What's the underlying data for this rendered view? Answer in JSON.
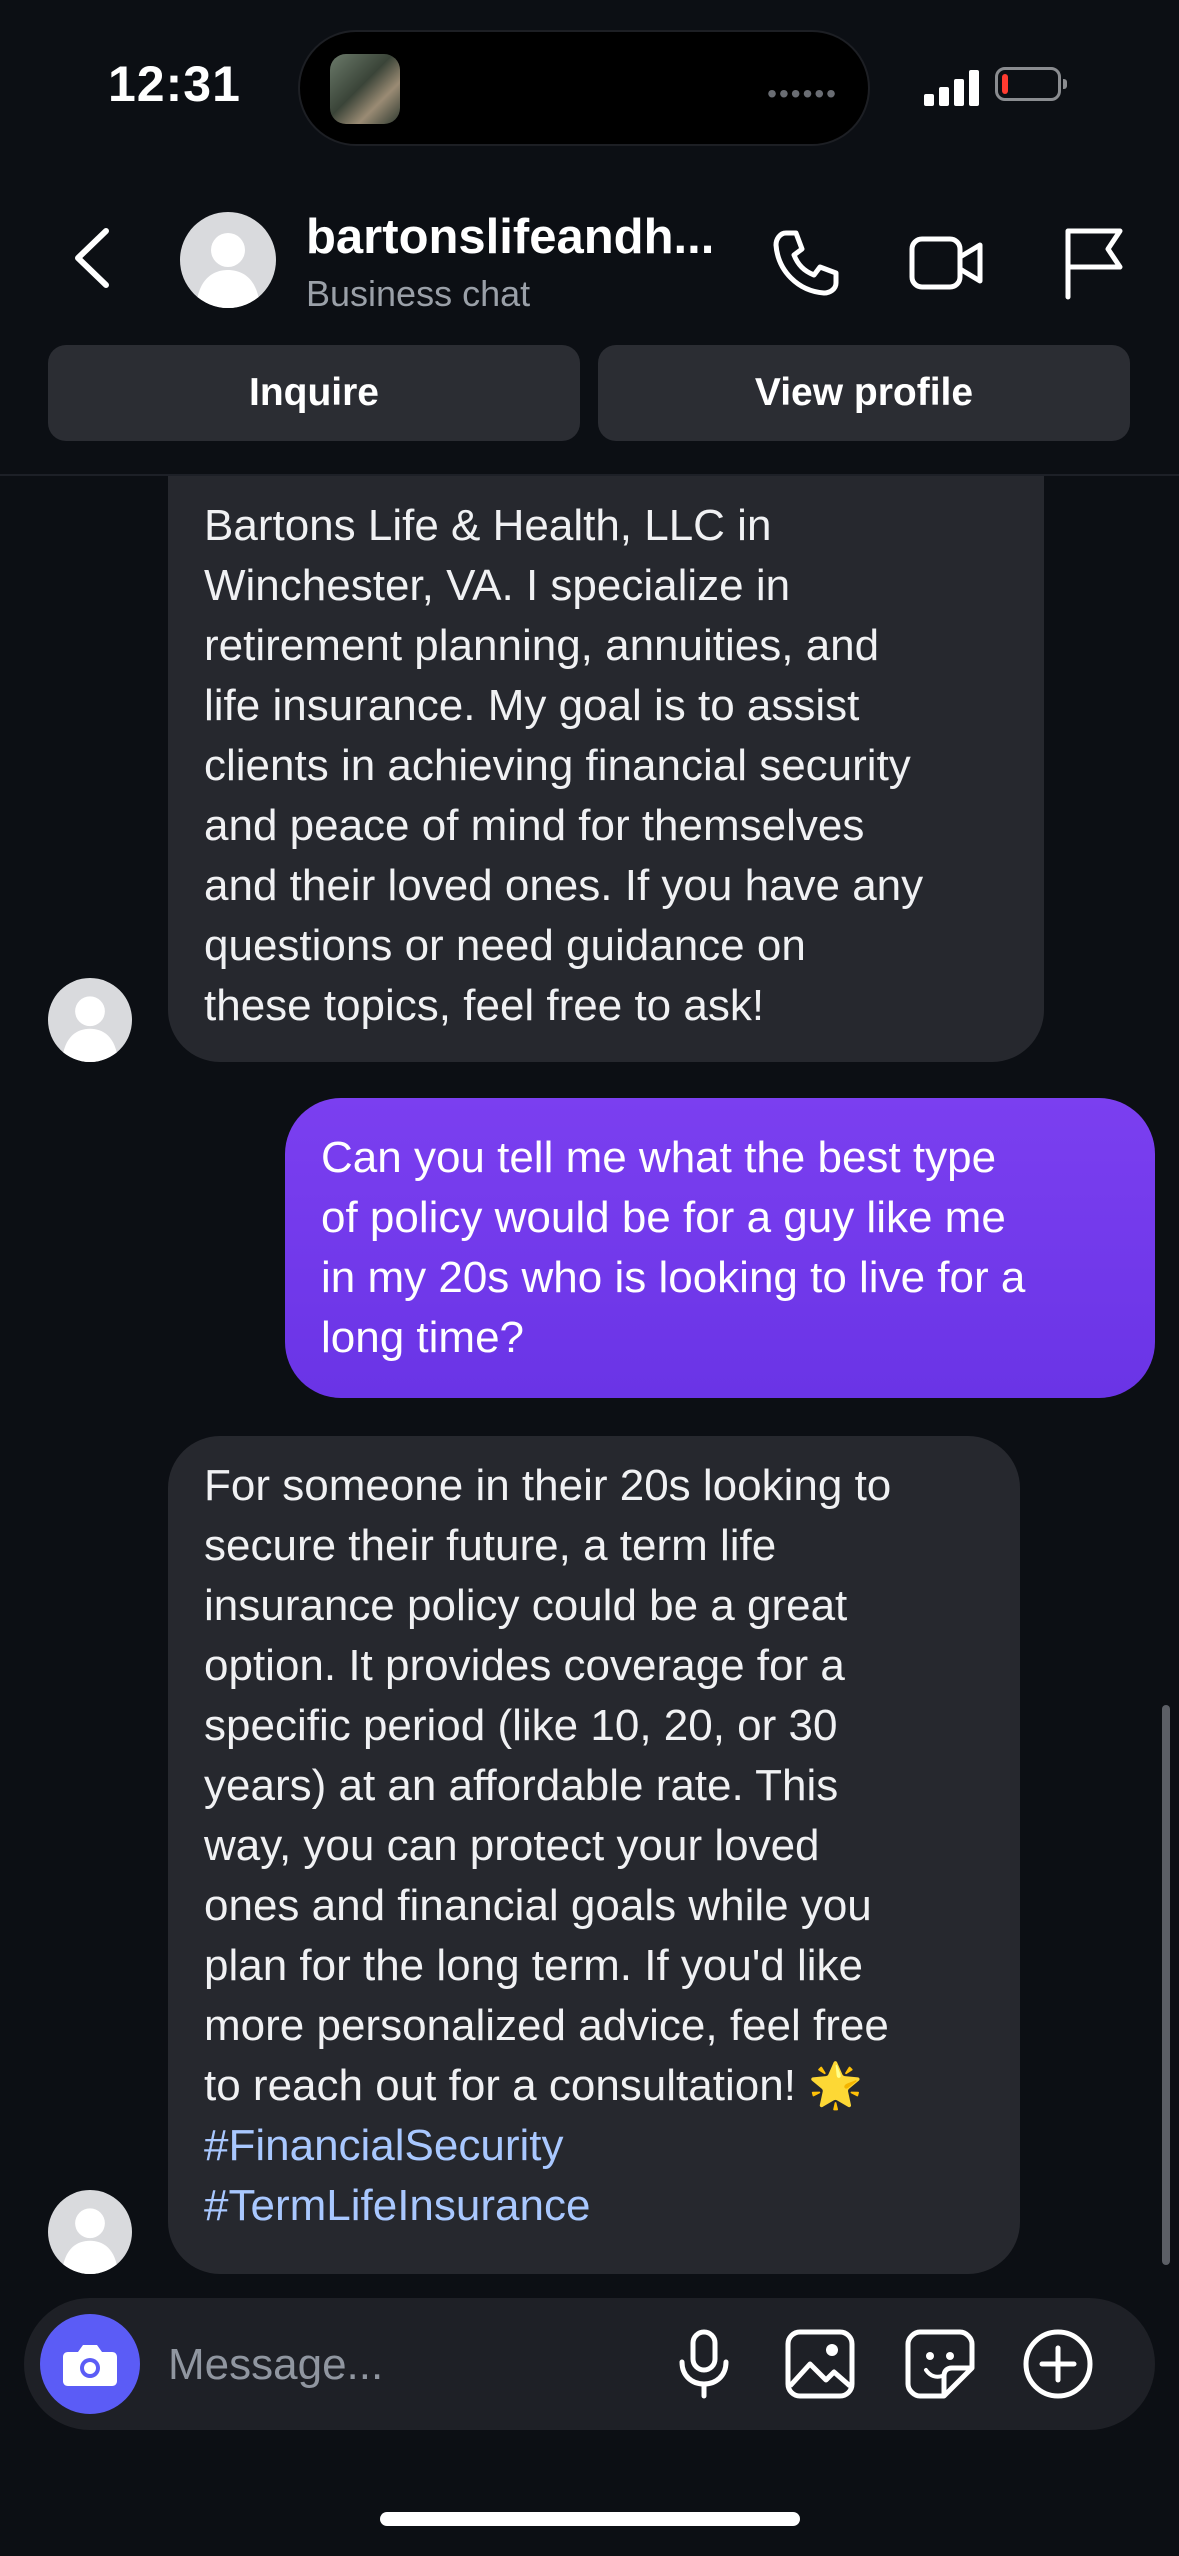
{
  "status_bar": {
    "time": "12:31",
    "island_dots": "••••••",
    "battery_color": "#ff3b30"
  },
  "header": {
    "name": "bartonslifeandh...",
    "subtitle": "Business chat",
    "icons": [
      "back-chevron-icon",
      "phone-icon",
      "video-camera-icon",
      "flag-icon"
    ]
  },
  "actions": {
    "inquire_label": "Inquire",
    "view_profile_label": "View profile"
  },
  "messages": [
    {
      "direction": "incoming",
      "lines": [
        "Bartons Life & Health, LLC in",
        "Winchester, VA. I specialize in",
        "retirement planning, annuities, and",
        "life insurance. My goal is to assist",
        "clients in achieving financial security",
        "and peace of mind for themselves",
        "and their loved ones. If you have any",
        "questions or need guidance on",
        "these topics, feel free to ask!"
      ]
    },
    {
      "direction": "outgoing",
      "lines": [
        "Can you tell me what the best type",
        "of policy would be for a guy like me",
        "in my 20s who is looking to live for a",
        "long time?"
      ]
    },
    {
      "direction": "incoming",
      "lines": [
        "For someone in their 20s looking to",
        "secure their future, a term life",
        "insurance policy could be a great",
        "option. It provides coverage for a",
        "specific period (like 10, 20, or 30",
        "years) at an affordable rate. This",
        "way, you can protect your loved",
        "ones and financial goals while you",
        "plan for the long term. If you'd like",
        "more personalized advice, feel free",
        "to reach out for a consultation! 🌟"
      ],
      "hashtags": [
        "#FinancialSecurity",
        "#TermLifeInsurance"
      ]
    }
  ],
  "composer": {
    "placeholder": "Message...",
    "icons": [
      "camera-icon",
      "microphone-icon",
      "gallery-icon",
      "sticker-icon",
      "add-icon"
    ]
  },
  "colors": {
    "background": "#0c0f14",
    "incoming_bubble": "#26282e",
    "outgoing_bubble": "#7138e8",
    "hashtag": "#a9c8ff",
    "camera_button": "#5b5cf6"
  }
}
